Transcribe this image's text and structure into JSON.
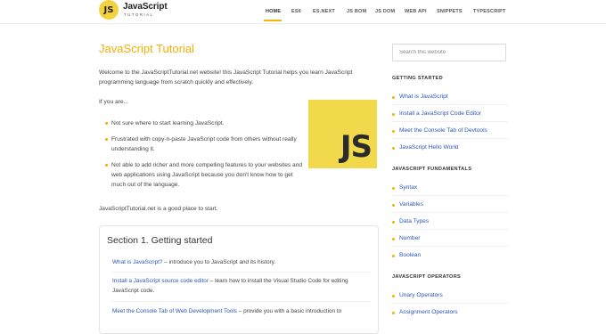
{
  "header": {
    "logo_mark": "JS",
    "logo_title": "JavaScript",
    "logo_subtitle": "TUTORIAL",
    "nav": [
      "HOME",
      "ES6",
      "ES.NEXT",
      "JS BOM",
      "JS DOM",
      "WEB API",
      "SNIPPETS",
      "TYPESCRIPT"
    ],
    "active_nav": "HOME"
  },
  "main": {
    "title": "JavaScript Tutorial",
    "intro": "Welcome to the JavaScriptTutorial.net website! this JavaScript Tutorial helps you learn JavaScript programming language from scratch quickly and effectively.",
    "if_you_are": "If you are...",
    "bullets": [
      "Not sure where to start learning JavaScript.",
      "Frustrated with copy-n-paste JavaScript code from others without really understanding it.",
      "Not able to add richer and more compelling features to your websites and web applications using JavaScript because you don't know how to get much out of the language."
    ],
    "js_logo": "JS",
    "good_place": "JavaScriptTutorial.net is a good place to start.",
    "section": {
      "title": "Section 1. Getting started",
      "items": [
        {
          "link": "What is JavaScript?",
          "desc": " – introduce you to JavaScript and its history."
        },
        {
          "link": "Install a JavaScript source code editor",
          "desc": " – learn how to install the Visual Studio Code for editing JavaScript code."
        },
        {
          "link": "Meet the Console Tab of Web Development Tools",
          "desc": " – provide you with a basic introduction to"
        }
      ]
    }
  },
  "sidebar": {
    "search_placeholder": "Search this website",
    "groups": [
      {
        "heading": "GETTING STARTED",
        "items": [
          "What is JavaScript",
          "Install a JavaScript Code Editor",
          "Meet the Console Tab of Devtools",
          "JavaScript Hello World"
        ]
      },
      {
        "heading": "JAVASCRIPT FUNDAMENTALS",
        "items": [
          "Syntax",
          "Variables",
          "Data Types",
          "Number",
          "Boolean"
        ]
      },
      {
        "heading": "JAVASCRIPT OPERATORS",
        "items": [
          "Unary Operators",
          "Assignment Operators"
        ]
      }
    ]
  },
  "colors": {
    "accent": "#f1b005",
    "link": "#2c56b8",
    "logo_yellow": "#f2d94c"
  }
}
